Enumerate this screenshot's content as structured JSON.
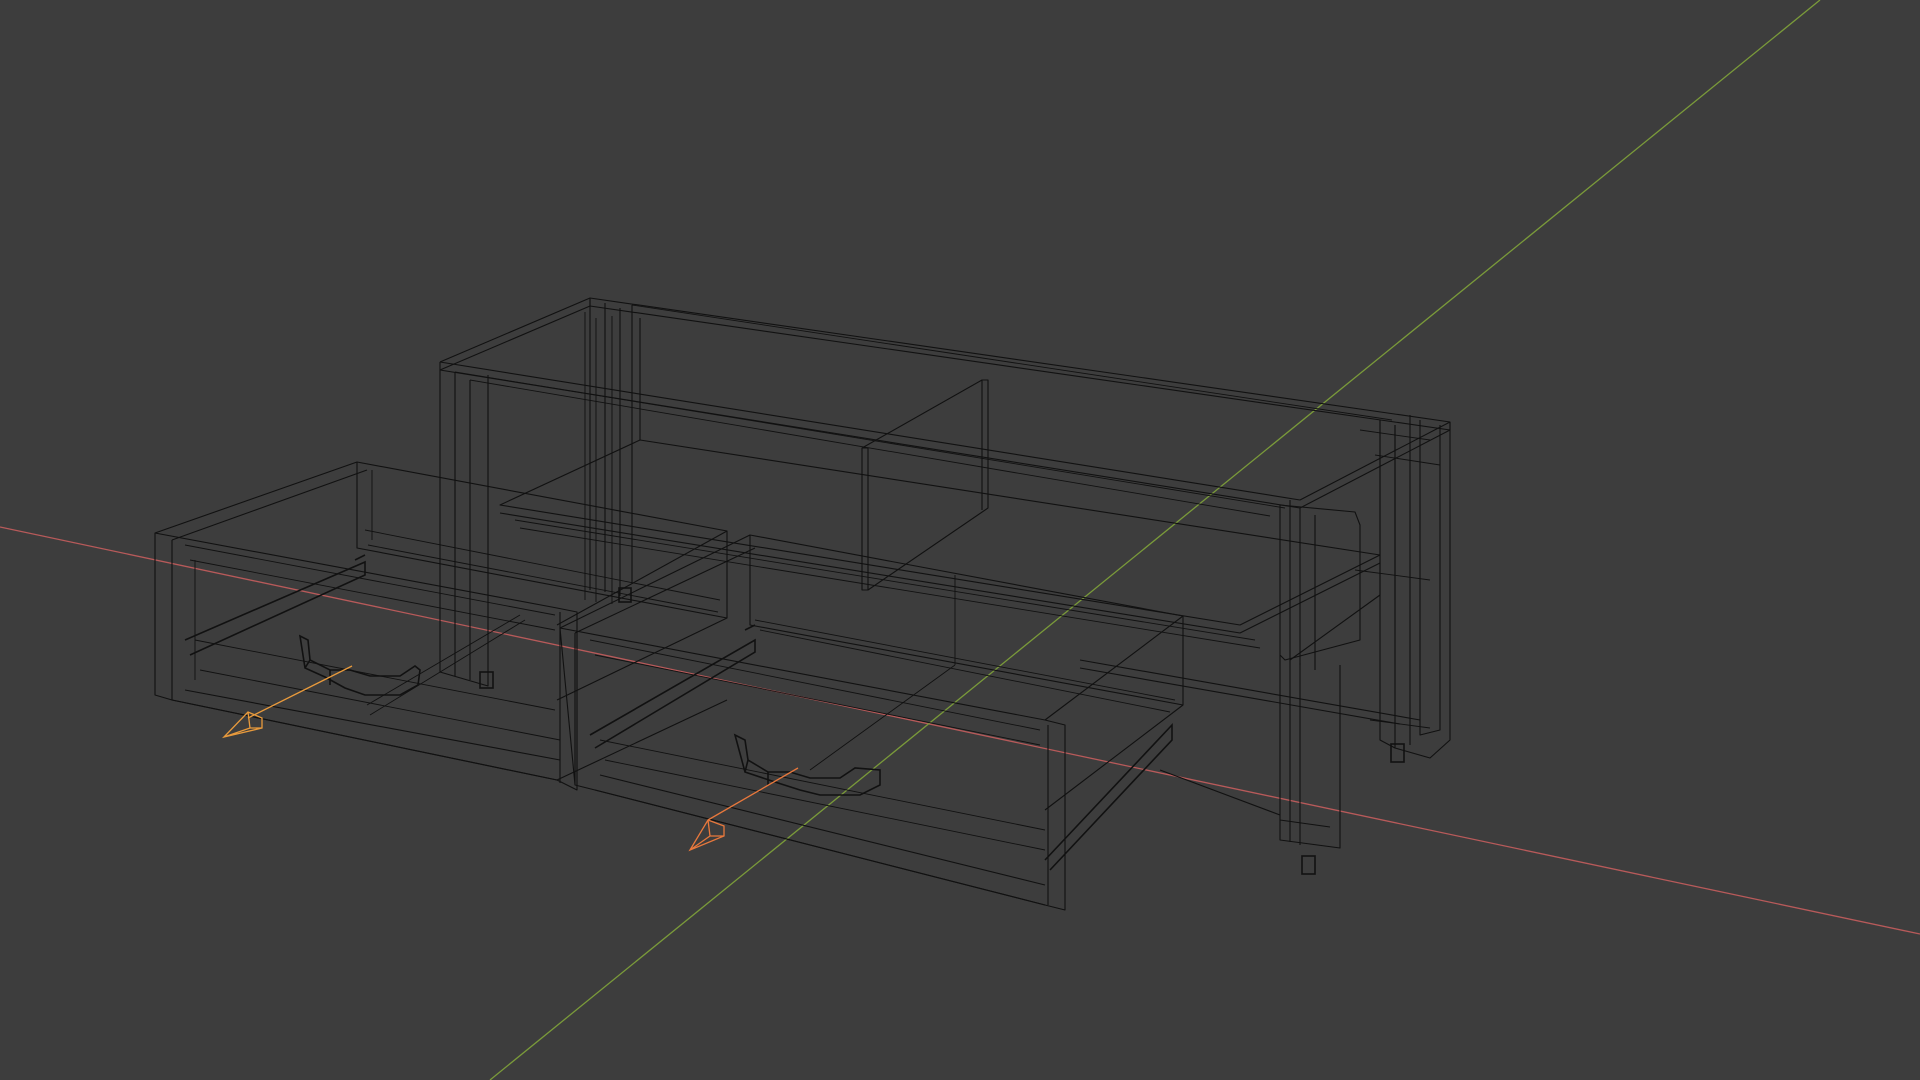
{
  "viewport": {
    "background_color": "#3d3d3d",
    "shading_mode": "wireframe",
    "wire_color": "#111111",
    "axes": {
      "x_axis_color": "#b85a5a",
      "y_axis_color": "#7a9a3a"
    },
    "object": "tv-stand-cabinet-with-two-open-drawers",
    "selected_empties": [
      {
        "name": "drawer-arrow-left",
        "color": "#e89a3c"
      },
      {
        "name": "drawer-arrow-right",
        "color": "#e8783c"
      }
    ]
  }
}
